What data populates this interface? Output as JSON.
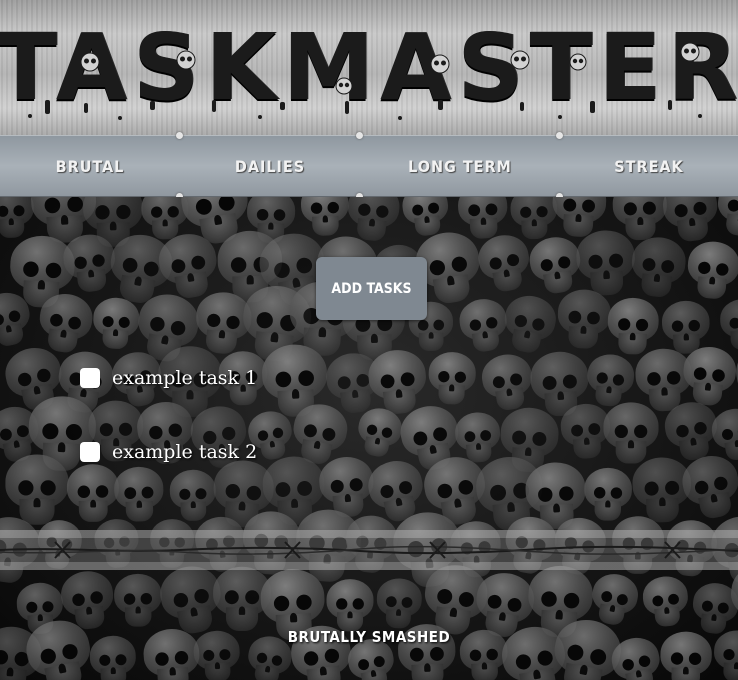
{
  "header": {
    "title": "TASKMASTER"
  },
  "nav": {
    "items": [
      {
        "label": "BRUTAL"
      },
      {
        "label": "DAILIES"
      },
      {
        "label": "LONG TERM"
      },
      {
        "label": "STREAK"
      }
    ]
  },
  "main": {
    "add_button_label": "ADD TASKS",
    "tasks": [
      {
        "label": "example task 1",
        "checked": false
      },
      {
        "label": "example task 2",
        "checked": false
      }
    ]
  },
  "footer": {
    "text": "BRUTALLY SMASHED"
  },
  "colors": {
    "nav_bar": "#9aa3ab",
    "button": "#7f8891",
    "title": "#1b1b1b"
  }
}
